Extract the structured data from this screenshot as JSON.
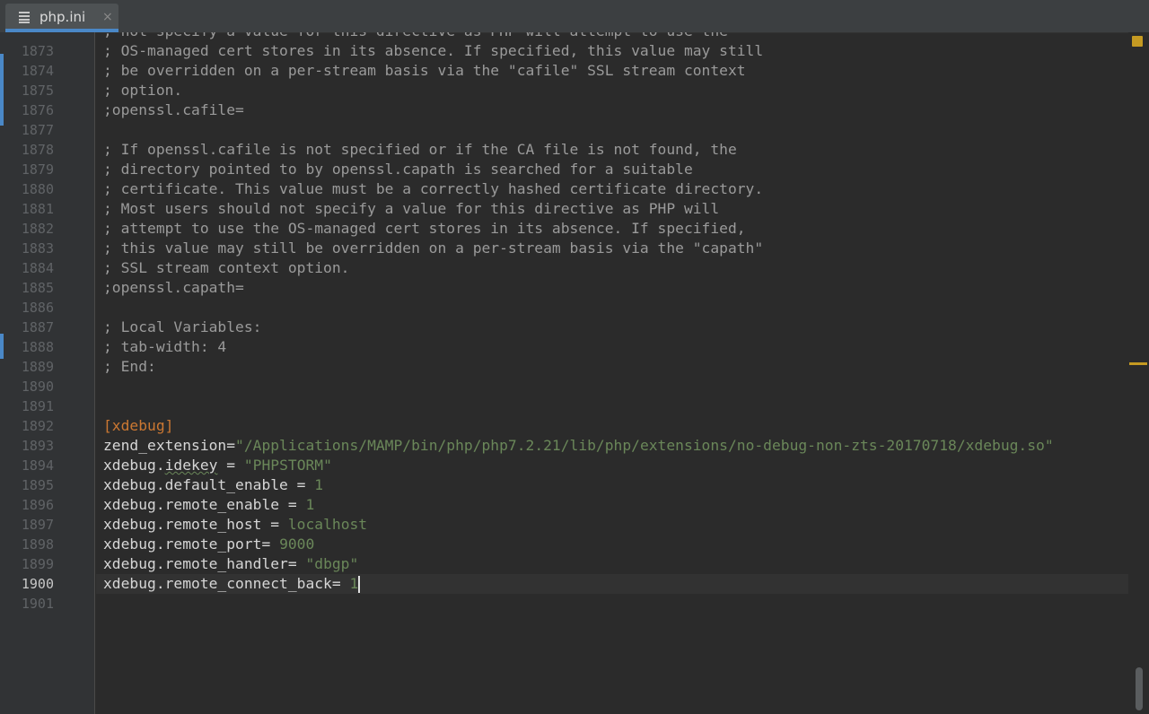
{
  "tab": {
    "filename": "php.ini",
    "close_glyph": "×",
    "icon": "ini-file-icon"
  },
  "colors": {
    "accent": "#4a88c7",
    "comment": "#9a9a9a",
    "section": "#cc7832",
    "string_value": "#6a8759",
    "warning": "#c59a22"
  },
  "editor": {
    "first_partial_line": "; not specify a value for this directive as PHP will attempt to use the",
    "current_line": "1900",
    "lines": [
      {
        "num": "1873",
        "text": "; OS-managed cert stores in its absence. If specified, this value may still"
      },
      {
        "num": "1874",
        "text": "; be overridden on a per-stream basis via the \"cafile\" SSL stream context"
      },
      {
        "num": "1875",
        "text": "; option."
      },
      {
        "num": "1876",
        "text": ";openssl.cafile="
      },
      {
        "num": "1877",
        "text": ""
      },
      {
        "num": "1878",
        "text": "; If openssl.cafile is not specified or if the CA file is not found, the"
      },
      {
        "num": "1879",
        "text": "; directory pointed to by openssl.capath is searched for a suitable"
      },
      {
        "num": "1880",
        "text": "; certificate. This value must be a correctly hashed certificate directory."
      },
      {
        "num": "1881",
        "text": "; Most users should not specify a value for this directive as PHP will"
      },
      {
        "num": "1882",
        "text": "; attempt to use the OS-managed cert stores in its absence. If specified,"
      },
      {
        "num": "1883",
        "text": "; this value may still be overridden on a per-stream basis via the \"capath\""
      },
      {
        "num": "1884",
        "text": "; SSL stream context option."
      },
      {
        "num": "1885",
        "text": ";openssl.capath="
      },
      {
        "num": "1886",
        "text": ""
      },
      {
        "num": "1887",
        "text": "; Local Variables:"
      },
      {
        "num": "1888",
        "text": "; tab-width: 4"
      },
      {
        "num": "1889",
        "text": "; End:"
      },
      {
        "num": "1890",
        "text": ""
      },
      {
        "num": "1891",
        "text": ""
      },
      {
        "num": "1892",
        "text": "[xdebug]"
      },
      {
        "num": "1893",
        "key": "zend_extension",
        "op": "=",
        "value": "\"/Applications/MAMP/bin/php/php7.2.21/lib/php/extensions/no-debug-non-zts-20170718/xdebug.so\""
      },
      {
        "num": "1894",
        "key": "xdebug.idekey",
        "op": " = ",
        "value": "\"PHPSTORM\""
      },
      {
        "num": "1895",
        "key": "xdebug.default_enable",
        "op": " = ",
        "value": "1"
      },
      {
        "num": "1896",
        "key": "xdebug.remote_enable",
        "op": " = ",
        "value": "1"
      },
      {
        "num": "1897",
        "key": "xdebug.remote_host",
        "op": " = ",
        "value": "localhost"
      },
      {
        "num": "1898",
        "key": "xdebug.remote_port",
        "op": "= ",
        "value": "9000"
      },
      {
        "num": "1899",
        "key": "xdebug.remote_handler",
        "op": "= ",
        "value": "\"dbgp\""
      },
      {
        "num": "1900",
        "key": "xdebug.remote_connect_back",
        "op": "= ",
        "value": "1"
      },
      {
        "num": "1901",
        "text": ""
      }
    ]
  }
}
